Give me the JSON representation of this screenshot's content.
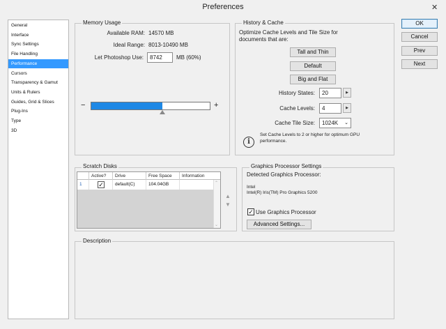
{
  "window": {
    "title": "Preferences",
    "close_glyph": "✕"
  },
  "nav": {
    "items": [
      {
        "label": "General"
      },
      {
        "label": "Interface"
      },
      {
        "label": "Sync Settings"
      },
      {
        "label": "File Handling"
      },
      {
        "label": "Performance",
        "selected": true
      },
      {
        "label": "Cursors"
      },
      {
        "label": "Transparency & Gamut"
      },
      {
        "label": "Units & Rulers"
      },
      {
        "label": "Guides, Grid & Slices"
      },
      {
        "label": "Plug-Ins"
      },
      {
        "label": "Type"
      },
      {
        "label": "3D"
      }
    ]
  },
  "memory": {
    "title": "Memory Usage",
    "available_label": "Available RAM:",
    "available_value": "14570 MB",
    "ideal_label": "Ideal Range:",
    "ideal_value": "8013-10490 MB",
    "let_label": "Let Photoshop Use:",
    "let_value": "8742",
    "let_suffix": "MB (60%)",
    "minus": "−",
    "plus": "+",
    "slider_fraction": 0.6
  },
  "history": {
    "title": "History & Cache",
    "desc_line1": "Optimize Cache Levels and Tile Size for",
    "desc_line2": "documents that are:",
    "btn_tall": "Tall and Thin",
    "btn_default": "Default",
    "btn_big": "Big and Flat",
    "states_label": "History States:",
    "states_value": "20",
    "levels_label": "Cache Levels:",
    "levels_value": "4",
    "tile_label": "Cache Tile Size:",
    "tile_value": "1024K",
    "info_glyph": "i",
    "note_line1": "Set Cache Levels to 2 or higher for optimum GPU",
    "note_line2": "performance."
  },
  "scratch": {
    "title": "Scratch Disks",
    "columns": [
      "Active?",
      "Drive",
      "Free Space",
      "Information"
    ],
    "rows": [
      {
        "index": "1",
        "active": "✓",
        "drive": "default(C)",
        "free": "104.04GB",
        "info": ""
      }
    ]
  },
  "gpu": {
    "title": "Graphics Processor Settings",
    "detected_label": "Detected Graphics Processor:",
    "vendor": "Intel",
    "model": "Intel(R) Iris(TM) Pro Graphics 5200",
    "use_checked": "✓",
    "use_label": "Use Graphics Processor",
    "advanced_btn": "Advanced Settings..."
  },
  "description": {
    "title": "Description"
  },
  "actions": {
    "ok": "OK",
    "cancel": "Cancel",
    "prev": "Prev",
    "next": "Next"
  },
  "colors": {
    "accent": "#3399ff",
    "slider_fill": "#1e88e5",
    "window_bg": "#f0f0f0"
  }
}
